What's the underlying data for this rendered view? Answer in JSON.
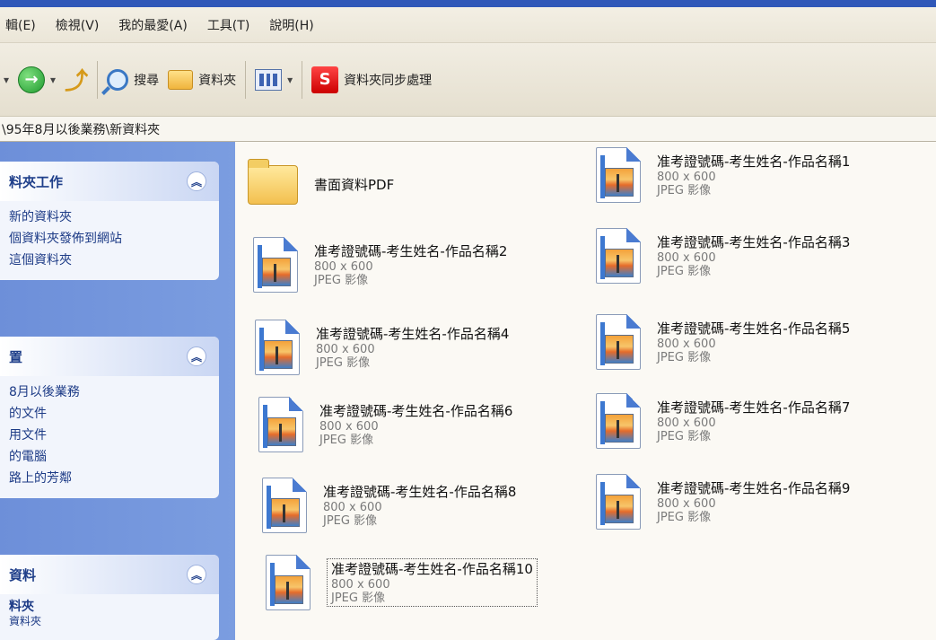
{
  "menu": [
    "輯(E)",
    "檢視(V)",
    "我的最愛(A)",
    "工具(T)",
    "說明(H)"
  ],
  "toolbar": {
    "search_label": "搜尋",
    "folders_label": "資料夾",
    "sync_label": "資料夾同步處理"
  },
  "address": "\\95年8月以後業務\\新資料夾",
  "left": {
    "panel1": {
      "title": "料夾工作",
      "links": [
        "新的資料夾",
        "個資料夾發佈到網站",
        "這個資料夾"
      ]
    },
    "panel2": {
      "title": "置",
      "links": [
        "8月以後業務",
        "的文件",
        "用文件",
        "的電腦",
        "路上的芳鄰"
      ]
    },
    "panel3": {
      "title": "資料",
      "links": [
        "料夾",
        "資料夾"
      ]
    }
  },
  "folder": {
    "name": "書面資料PDF"
  },
  "files": [
    {
      "name": "准考證號碼-考生姓名-作品名稱1",
      "size": "800 x 600",
      "type": "JPEG 影像"
    },
    {
      "name": "准考證號碼-考生姓名-作品名稱2",
      "size": "800 x 600",
      "type": "JPEG 影像"
    },
    {
      "name": "准考證號碼-考生姓名-作品名稱3",
      "size": "800 x 600",
      "type": "JPEG 影像"
    },
    {
      "name": "准考證號碼-考生姓名-作品名稱4",
      "size": "800 x 600",
      "type": "JPEG 影像"
    },
    {
      "name": "准考證號碼-考生姓名-作品名稱5",
      "size": "800 x 600",
      "type": "JPEG 影像"
    },
    {
      "name": "准考證號碼-考生姓名-作品名稱6",
      "size": "800 x 600",
      "type": "JPEG 影像"
    },
    {
      "name": "准考證號碼-考生姓名-作品名稱7",
      "size": "800 x 600",
      "type": "JPEG 影像"
    },
    {
      "name": "准考證號碼-考生姓名-作品名稱8",
      "size": "800 x 600",
      "type": "JPEG 影像"
    },
    {
      "name": "准考證號碼-考生姓名-作品名稱9",
      "size": "800 x 600",
      "type": "JPEG 影像"
    },
    {
      "name": "准考證號碼-考生姓名-作品名稱10",
      "size": "800 x 600",
      "type": "JPEG 影像"
    }
  ]
}
